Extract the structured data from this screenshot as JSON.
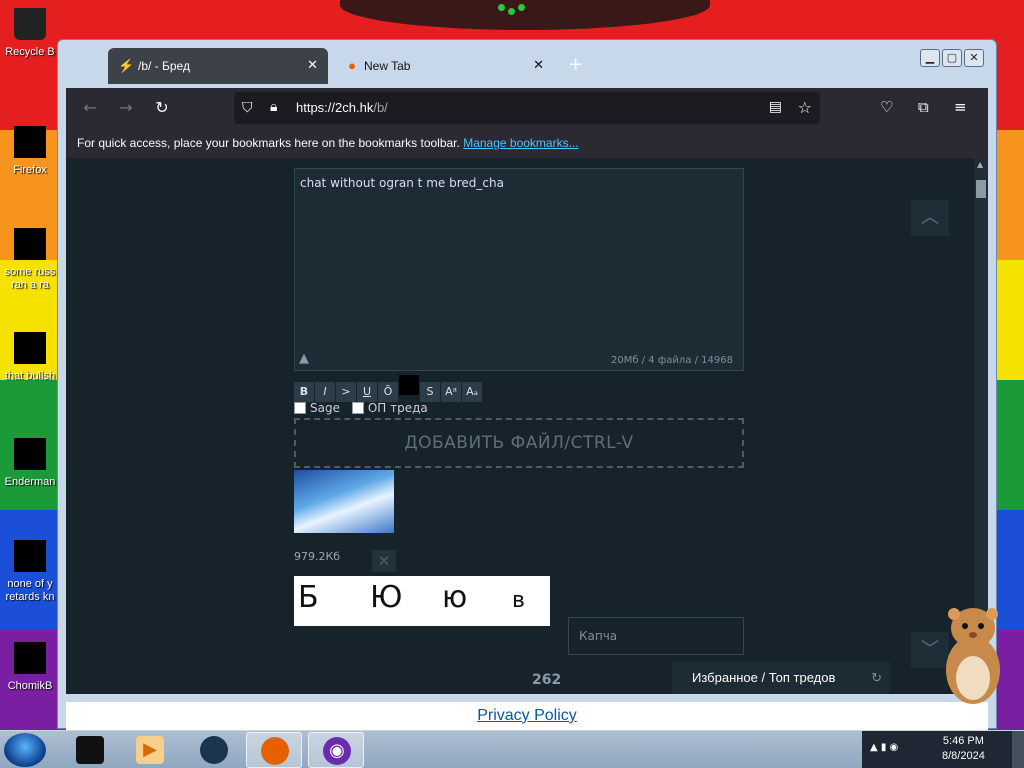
{
  "desktop": {
    "icons": [
      {
        "label": "Recycle B"
      },
      {
        "label": "Firefox"
      },
      {
        "label": "some russ ran a ra"
      },
      {
        "label": "that bullsh"
      },
      {
        "label": "Enderman"
      },
      {
        "label": "none of y retards kn"
      },
      {
        "label": "ChomikB"
      }
    ]
  },
  "browser": {
    "tabs": [
      {
        "label": "/b/ - Бред",
        "icon": "bolt-icon",
        "active": true
      },
      {
        "label": "New Tab",
        "icon": "firefox-icon",
        "active": false
      }
    ],
    "url_host": "https://2ch.hk",
    "url_path": "/b/",
    "bookmarks_text": "For quick access, place your bookmarks here on the bookmarks toolbar.",
    "bookmarks_link": "Manage bookmarks..."
  },
  "post_form": {
    "message": "chat without ogran t me bred_cha",
    "counter": "20Мб / 4 файла / 14968",
    "format_buttons": [
      "B",
      "I",
      ">",
      "U",
      "Ō",
      "",
      "S",
      "Aᵃ",
      "Aₐ"
    ],
    "sage_label": "Sage",
    "op_label": "ОП треда",
    "add_file_label": "ДОБАВИТЬ ФАЙЛ/CTRL-V",
    "file_size": "979.2Кб",
    "captcha_chars": [
      "Б",
      "Ю",
      "ю",
      "в"
    ],
    "captcha_placeholder": "Капча"
  },
  "page": {
    "count": "262",
    "favorites": "Избранное / Топ тредов",
    "privacy_link": "Privacy Policy"
  },
  "taskbar": {
    "time": "5:46 PM",
    "date": "8/8/2024"
  }
}
